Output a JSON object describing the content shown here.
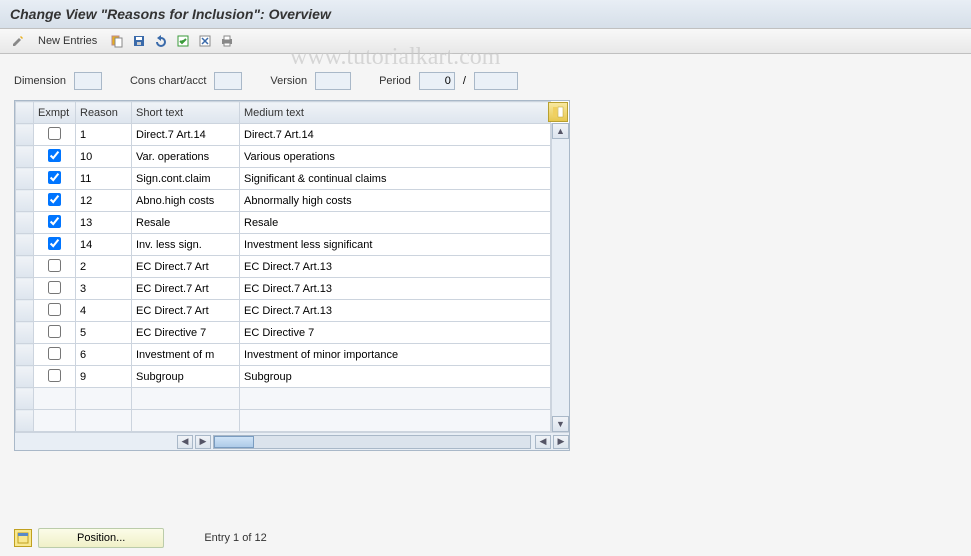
{
  "title": "Change View \"Reasons for Inclusion\": Overview",
  "toolbar": {
    "new_entries": "New Entries"
  },
  "watermark": "www.tutorialkart.com",
  "filters": {
    "dimension_label": "Dimension",
    "dimension_value": "",
    "cons_label": "Cons chart/acct",
    "cons_value": "",
    "version_label": "Version",
    "version_value": "",
    "period_label": "Period",
    "period_value": "0",
    "period_sep": "/",
    "period_value2": ""
  },
  "columns": {
    "exmpt": "Exmpt",
    "reason": "Reason",
    "short": "Short text",
    "medium": "Medium text"
  },
  "rows": [
    {
      "exmpt": false,
      "reason": "1",
      "short": "Direct.7 Art.14",
      "medium": "Direct.7 Art.14"
    },
    {
      "exmpt": true,
      "reason": "10",
      "short": "Var. operations",
      "medium": "Various operations"
    },
    {
      "exmpt": true,
      "reason": "11",
      "short": "Sign.cont.claim",
      "medium": "Significant & continual claims"
    },
    {
      "exmpt": true,
      "reason": "12",
      "short": "Abno.high costs",
      "medium": "Abnormally high costs"
    },
    {
      "exmpt": true,
      "reason": "13",
      "short": "Resale",
      "medium": "Resale"
    },
    {
      "exmpt": true,
      "reason": "14",
      "short": "Inv. less sign.",
      "medium": "Investment less significant"
    },
    {
      "exmpt": false,
      "reason": "2",
      "short": "EC Direct.7 Art",
      "medium": "EC Direct.7 Art.13"
    },
    {
      "exmpt": false,
      "reason": "3",
      "short": "EC Direct.7 Art",
      "medium": "EC Direct.7 Art.13"
    },
    {
      "exmpt": false,
      "reason": "4",
      "short": "EC Direct.7 Art",
      "medium": "EC Direct.7 Art.13"
    },
    {
      "exmpt": false,
      "reason": "5",
      "short": "EC Directive 7",
      "medium": "EC Directive 7"
    },
    {
      "exmpt": false,
      "reason": "6",
      "short": "Investment of m",
      "medium": "Investment of minor importance"
    },
    {
      "exmpt": false,
      "reason": "9",
      "short": "Subgroup",
      "medium": "Subgroup"
    }
  ],
  "blank_rows": 2,
  "footer": {
    "position_label": "Position...",
    "entry_count": "Entry 1 of 12"
  }
}
